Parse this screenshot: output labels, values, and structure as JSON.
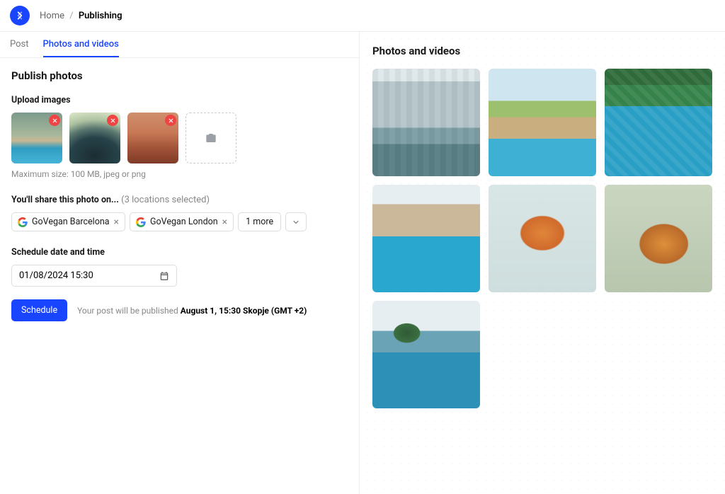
{
  "breadcrumb": {
    "home": "Home",
    "current": "Publishing"
  },
  "tabs": {
    "post": "Post",
    "photos": "Photos and videos"
  },
  "page_title": "Publish photos",
  "upload": {
    "label": "Upload images",
    "hint": "Maximum size: 100 MB, jpeg or png",
    "thumbs": [
      {
        "name": "thumb-1",
        "palette": "t1"
      },
      {
        "name": "thumb-2",
        "palette": "t2"
      },
      {
        "name": "thumb-3",
        "palette": "t3"
      }
    ]
  },
  "share": {
    "label": "You'll share this photo on...",
    "meta": "(3 locations selected)",
    "chips": [
      {
        "label": "GoVegan Barcelona"
      },
      {
        "label": "GoVegan London"
      }
    ],
    "more": "1 more"
  },
  "schedule": {
    "label": "Schedule date and time",
    "value": "01/08/2024 15:30"
  },
  "footer": {
    "button": "Schedule",
    "hint_prefix": "Your post will be published ",
    "hint_bold": "August 1, 15:30 Skopje (GMT +2)"
  },
  "preview": {
    "title": "Photos and videos",
    "items": [
      {
        "name": "gallery-hotel-courtyard",
        "palette": "p1"
      },
      {
        "name": "gallery-palm-pool",
        "palette": "p2"
      },
      {
        "name": "gallery-pool-aerial",
        "palette": "p3"
      },
      {
        "name": "gallery-resort-pool-beige",
        "palette": "p4"
      },
      {
        "name": "gallery-smoothie-fruit",
        "palette": "p5"
      },
      {
        "name": "gallery-food-plate",
        "palette": "p6"
      },
      {
        "name": "gallery-infinity-pool-trees",
        "palette": "p7"
      }
    ]
  }
}
